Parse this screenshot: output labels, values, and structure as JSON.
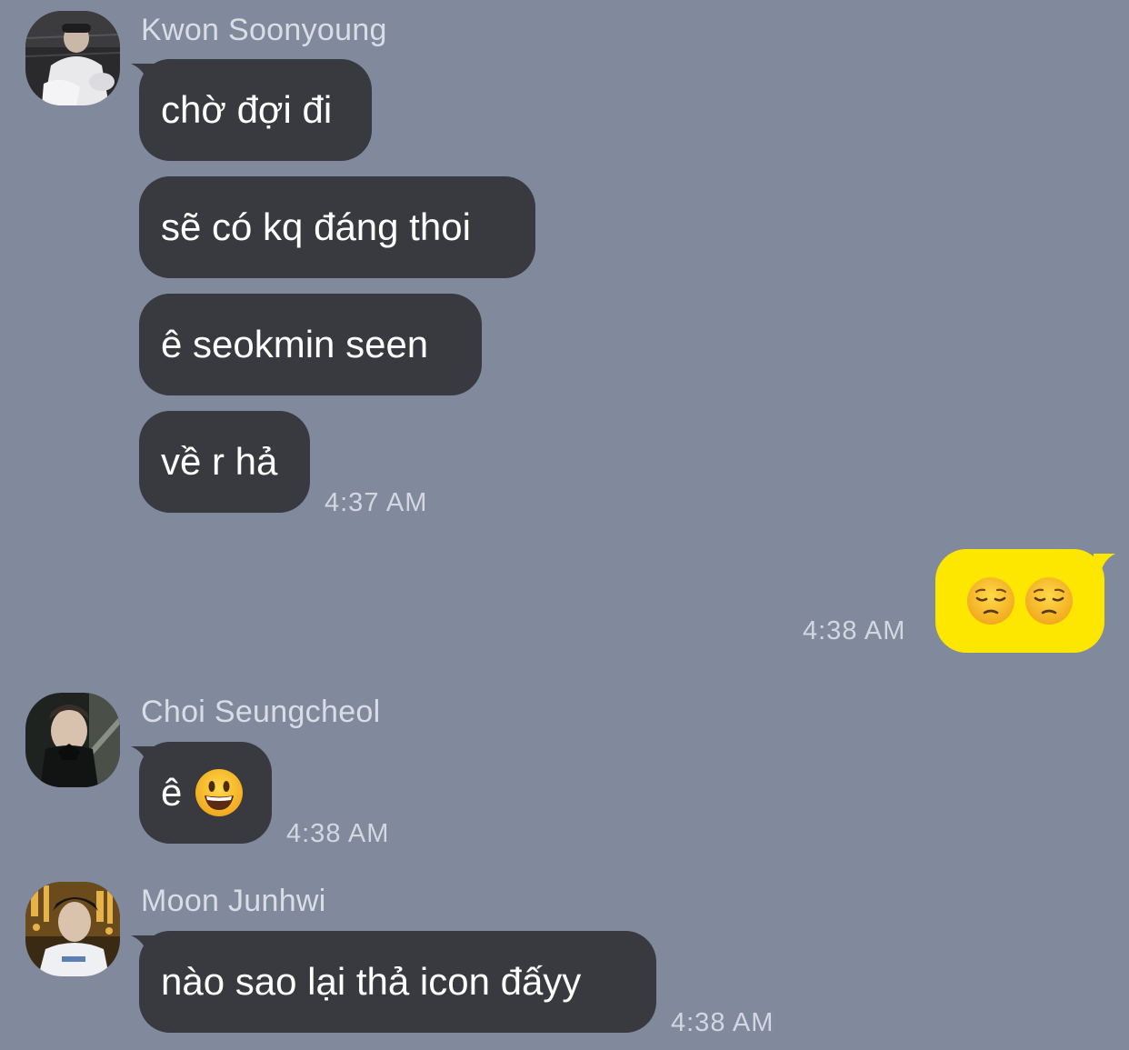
{
  "thread": [
    {
      "sender": "Kwon Soonyoung",
      "messages": [
        "chờ đợi đi",
        "sẽ có kq đáng thoi",
        "ê seokmin seen",
        "về r hả"
      ],
      "time": "4:37 AM"
    },
    {
      "sender": "me",
      "message_emoji": [
        "pensive-face-emoji",
        "pensive-face-emoji"
      ],
      "time": "4:38 AM"
    },
    {
      "sender": "Choi Seungcheol",
      "message_text": "ê",
      "message_emoji": "smiley-face-emoji",
      "time": "4:38 AM"
    },
    {
      "sender": "Moon Junhwi",
      "messages": [
        "nào sao lại thả icon đấyy"
      ],
      "time": "4:38 AM"
    }
  ],
  "colors": {
    "background": "#808a9c",
    "incoming_bubble": "#393a3f",
    "outgoing_bubble": "#fde600",
    "text": "#ffffff",
    "meta_text": "#d2d7e0"
  }
}
